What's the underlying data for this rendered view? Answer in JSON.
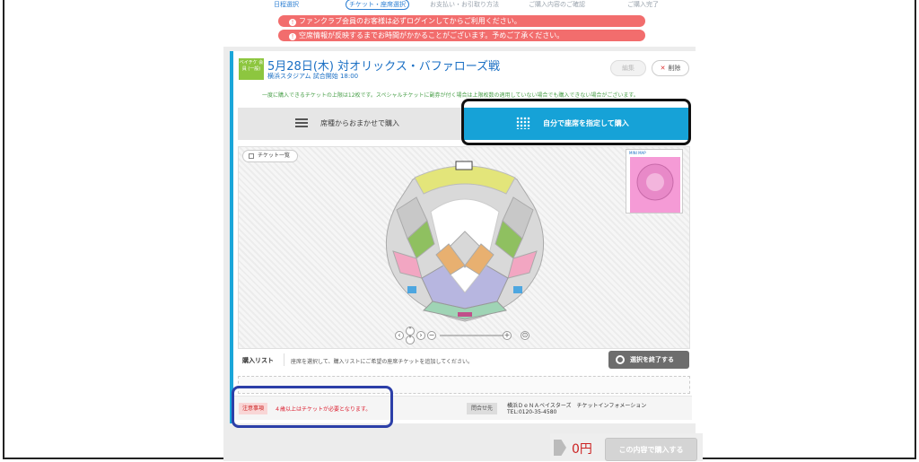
{
  "steps": [
    "日程選択",
    "チケット・座席選択",
    "お支払い・お引取り方法",
    "ご購入内容のご確認",
    "ご購入完了"
  ],
  "alerts": [
    "ファンクラブ会員のお客様は必ずログインしてからご利用ください。",
    "空席情報が反映するまでお時間がかかることがございます。予めご了承ください。"
  ],
  "game": {
    "badge": "ベイチケ 会員 (一般)",
    "title": "5月28日(木) 対オリックス・バファローズ戦",
    "venue": "横浜スタジアム 試合開始 18:00"
  },
  "buttons": {
    "edit": "編集",
    "delete": "削除",
    "end_selection": "選択を終了する",
    "buy": "この内容で購入する"
  },
  "notice": "一度に購入できるチケットの上限は12枚です。スペシャルチケットに副券が付く場合は上限枚数の適用していない場合でも購入できない場合がございます。",
  "tabs": {
    "auto": "席種からおまかせで購入",
    "manual": "自分で座席を指定して購入"
  },
  "map": {
    "ticket_list": "チケット一覧",
    "mini_map": "MINI MAP"
  },
  "purchase_list": {
    "label": "購入リスト",
    "desc": "座席を選択して、購入リストにご希望の座席チケットを追加してください。"
  },
  "footer": {
    "caution_tag": "注意事項",
    "caution_text": "４歳以上はチケットが必要となります。",
    "contact_tag": "問合せ先",
    "contact_name": "横浜ＤｅＮＡベイスターズ　チケットインフォメーション",
    "contact_tel": "TEL:0120-35-4580"
  },
  "total": {
    "price": "0円"
  },
  "colors": {
    "accent": "#16a2d7",
    "alert": "#f26d6d",
    "title": "#1a6fc4"
  }
}
